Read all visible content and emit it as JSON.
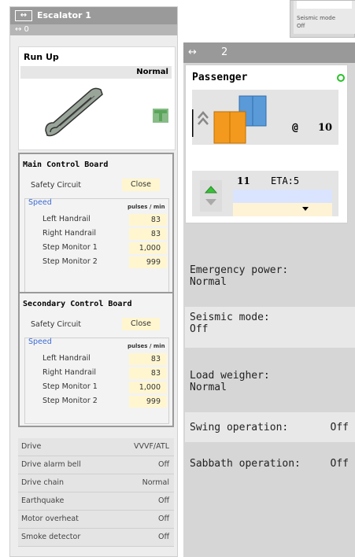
{
  "escalator": {
    "title": "Escalator 1",
    "title_icon": "double-arrow-icon",
    "sub_label": "↔ 0",
    "direction_label": "Run Up",
    "direction_value": "Normal",
    "main_board": {
      "title": "Main Control Board",
      "safety_circuit_label": "Safety Circuit",
      "safety_circuit_value": "Close",
      "speed_label": "Speed",
      "units": "pulses / min",
      "rows": [
        {
          "label": "Left Handrail",
          "value": "83"
        },
        {
          "label": "Right Handrail",
          "value": "83"
        },
        {
          "label": "Step Monitor 1",
          "value": "1,000"
        },
        {
          "label": "Step Monitor 2",
          "value": "999"
        }
      ]
    },
    "secondary_board": {
      "title": "Secondary Control Board",
      "safety_circuit_label": "Safety Circuit",
      "safety_circuit_value": "Close",
      "speed_label": "Speed",
      "units": "pulses / min",
      "rows": [
        {
          "label": "Left Handrail",
          "value": "83"
        },
        {
          "label": "Right Handrail",
          "value": "83"
        },
        {
          "label": "Step Monitor 1",
          "value": "1,000"
        },
        {
          "label": "Step Monitor 2",
          "value": "999"
        }
      ]
    },
    "status": [
      {
        "label": "Drive",
        "value": "VVVF/ATL"
      },
      {
        "label": "Drive alarm bell",
        "value": "Off"
      },
      {
        "label": "Drive chain",
        "value": "Normal"
      },
      {
        "label": "Earthquake",
        "value": "Off"
      },
      {
        "label": "Motor overheat",
        "value": "Off"
      },
      {
        "label": "Smoke detector",
        "value": "Off"
      }
    ]
  },
  "corner_panel": {
    "line1": "Seismic mode",
    "line2": "Off"
  },
  "elevator": {
    "header_icon": "↔",
    "number": "2",
    "car_type": "Passenger",
    "at_symbol": "@",
    "floor": "10",
    "call_floor": "11",
    "eta": "ETA:5",
    "status_color": "#27c227",
    "info": [
      {
        "label": "Emergency power:",
        "value": "Normal"
      },
      {
        "label": "Seismic mode:",
        "value": "Off"
      },
      {
        "label": "Load weigher:",
        "value": "Normal"
      },
      {
        "label": "Swing operation:",
        "value": "Off"
      },
      {
        "label": "Sabbath operation:",
        "value": "Off"
      }
    ]
  }
}
